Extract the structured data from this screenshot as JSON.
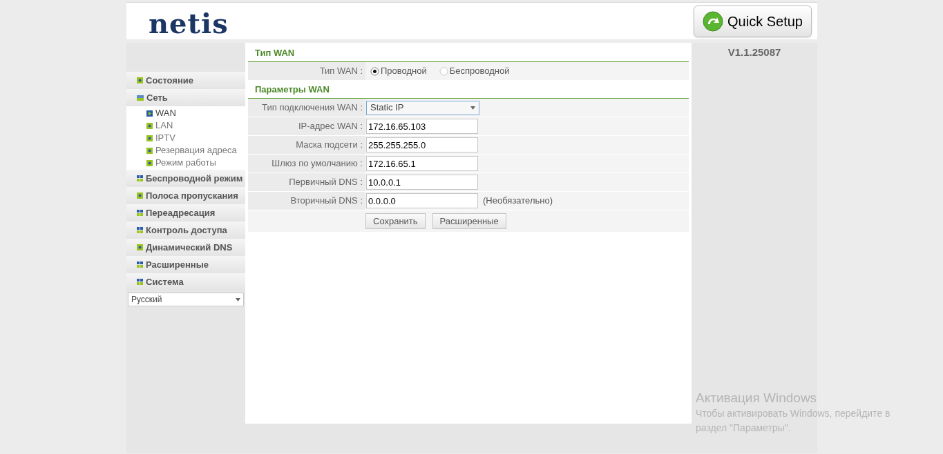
{
  "header": {
    "logo": "netis",
    "quick_setup": "Quick Setup"
  },
  "version": "V1.1.25087",
  "sidebar": {
    "items": [
      {
        "label": "Состояние",
        "kind": "leaf"
      },
      {
        "label": "Сеть",
        "kind": "folder",
        "expanded": true,
        "children": [
          {
            "label": "WAN",
            "selected": true
          },
          {
            "label": "LAN",
            "selected": false
          },
          {
            "label": "IPTV",
            "selected": false
          },
          {
            "label": "Резервация адреса",
            "selected": false
          },
          {
            "label": "Режим работы",
            "selected": false
          }
        ]
      },
      {
        "label": "Беспроводной режим",
        "kind": "folder",
        "expanded": false
      },
      {
        "label": "Полоса пропускания",
        "kind": "leaf"
      },
      {
        "label": "Переадресация",
        "kind": "folder",
        "expanded": false
      },
      {
        "label": "Контроль доступа",
        "kind": "folder",
        "expanded": false
      },
      {
        "label": "Динамический DNS",
        "kind": "leaf"
      },
      {
        "label": "Расширенные",
        "kind": "folder",
        "expanded": false
      },
      {
        "label": "Система",
        "kind": "folder",
        "expanded": false
      }
    ],
    "language": "Русский"
  },
  "sections": [
    {
      "title": "Тип WAN",
      "rows": [
        {
          "kind": "radio",
          "label": "Тип WAN :",
          "options": [
            {
              "label": "Проводной",
              "selected": true
            },
            {
              "label": "Беспроводной",
              "selected": false
            }
          ]
        }
      ]
    },
    {
      "title": "Параметры WAN",
      "rows": [
        {
          "kind": "select",
          "label": "Тип подключения WAN :",
          "value": "Static IP"
        },
        {
          "kind": "input",
          "label": "IP-адрес WAN :",
          "value": "172.16.65.103"
        },
        {
          "kind": "input",
          "label": "Маска подсети :",
          "value": "255.255.255.0"
        },
        {
          "kind": "input",
          "label": "Шлюз по умолчанию :",
          "value": "172.16.65.1"
        },
        {
          "kind": "input",
          "label": "Первичный DNS :",
          "value": "10.0.0.1"
        },
        {
          "kind": "input",
          "label": "Вторичный DNS :",
          "value": "0.0.0.0",
          "note": "(Необязательно)"
        }
      ]
    }
  ],
  "buttons": [
    "Сохранить",
    "Расширенные"
  ],
  "activation": {
    "title": "Активация Windows",
    "text": "Чтобы активировать Windows, перейдите в раздел \"Параметры\"."
  }
}
